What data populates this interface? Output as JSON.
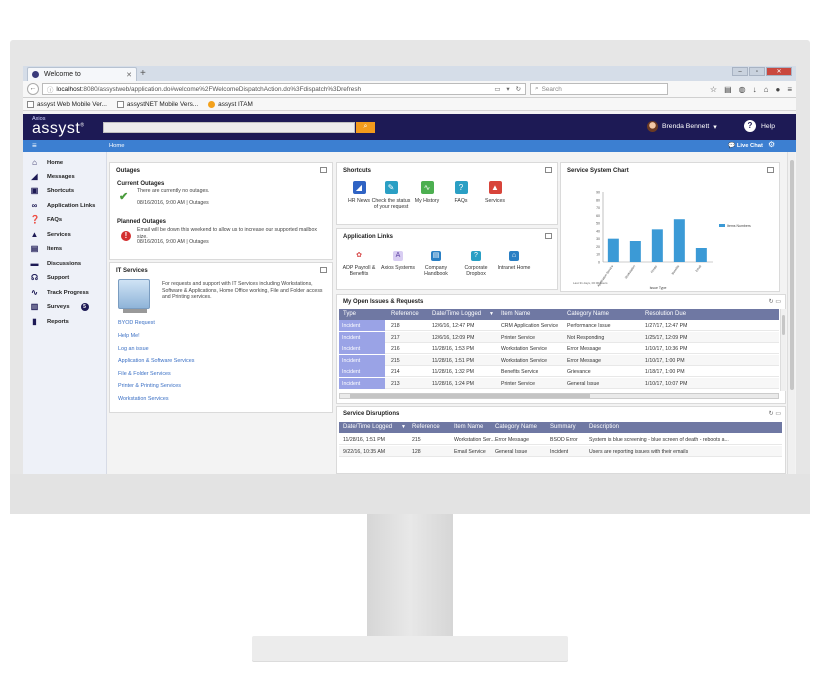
{
  "browser": {
    "tab_title": "Welcome to",
    "new_tab": "+",
    "url_host": "localhost",
    "url_rest": ":8080/assystweb/application.do#welcome%2FWelcomeDispatchAction.do%3Fdispatch%3Drefresh",
    "search_placeholder": "Search",
    "bookmarks": [
      "assyst Web Mobile Ver...",
      "assystNET Mobile Vers...",
      "assyst ITAM"
    ]
  },
  "app": {
    "logo_small": "Axios",
    "logo": "assyst",
    "user_name": "Brenda Bennett",
    "help_label": "Help",
    "breadcrumb": "Home",
    "live_chat": "Live Chat"
  },
  "sidebar": {
    "items": [
      {
        "label": "Home",
        "icon": "home-icon"
      },
      {
        "label": "Messages",
        "icon": "megaphone-icon"
      },
      {
        "label": "Shortcuts",
        "icon": "shortcuts-icon"
      },
      {
        "label": "Application Links",
        "icon": "link-icon"
      },
      {
        "label": "FAQs",
        "icon": "faq-icon"
      },
      {
        "label": "Services",
        "icon": "services-icon"
      },
      {
        "label": "Items",
        "icon": "items-icon"
      },
      {
        "label": "Discussions",
        "icon": "discussions-icon"
      },
      {
        "label": "Support",
        "icon": "support-icon"
      },
      {
        "label": "Track Progress",
        "icon": "track-progress-icon"
      },
      {
        "label": "Surveys",
        "icon": "surveys-icon",
        "badge": "5"
      },
      {
        "label": "Reports",
        "icon": "reports-icon"
      }
    ]
  },
  "outages": {
    "title": "Outages",
    "current_title": "Current Outages",
    "current_text": "There are currently no outages.",
    "current_meta": "08/16/2016, 9:00 AM  |  Outages",
    "planned_title": "Planned Outages",
    "planned_text": "Email will be down this weekend to allow us to increase our supported mailbox size.",
    "planned_meta": "08/16/2016, 9:00 AM  |  Outages"
  },
  "it_services": {
    "title": "IT Services",
    "description": "For requests and support with IT Services including Workstations, Software & Applications, Home Office working, File and Folder access and Printing services.",
    "links": [
      "BYOD Request",
      "Help Me!",
      "Log an issue",
      "Application & Software Services",
      "File & Folder Services",
      "Printer & Printing Services",
      "Workstation Services"
    ]
  },
  "shortcuts": {
    "title": "Shortcuts",
    "items": [
      {
        "label": "HR News",
        "color": "#2f63c4",
        "icon": "megaphone-icon"
      },
      {
        "label": "Check the status of your request",
        "color": "#2a9fc4",
        "icon": "lightbulb-icon"
      },
      {
        "label": "My History",
        "color": "#4caf50",
        "icon": "history-chart-icon"
      },
      {
        "label": "FAQs",
        "color": "#2a9fc4",
        "icon": "faq-icon"
      },
      {
        "label": "Services",
        "color": "#d8443a",
        "icon": "services-icon"
      }
    ]
  },
  "app_links": {
    "title": "Application Links",
    "items": [
      {
        "label": "ADP Payroll & Benefits",
        "icon": "payroll-icon"
      },
      {
        "label": "Axios Systems",
        "icon": "axios-icon"
      },
      {
        "label": "Company Handbook",
        "icon": "handbook-icon"
      },
      {
        "label": "Corporate Dropbox",
        "icon": "dropbox-icon"
      },
      {
        "label": "Intranet Home",
        "icon": "intranet-icon"
      }
    ]
  },
  "service_chart": {
    "title": "Service System Chart"
  },
  "chart_data": {
    "type": "bar",
    "categories": [
      "Application Service",
      "Workstation",
      "Printer",
      "Benefits",
      "Email"
    ],
    "values": [
      30,
      27,
      42,
      55,
      18
    ],
    "ylim": [
      0,
      90
    ],
    "yticks": [
      0,
      10,
      20,
      30,
      40,
      50,
      60,
      70,
      80,
      90
    ],
    "xlabel": "Issue Type",
    "legend": "Items Numbers",
    "footnote": "Last 31 days, 00:00 hours"
  },
  "open_issues": {
    "title": "My Open Issues & Requests",
    "columns": [
      "Type",
      "Reference",
      "Date/Time Logged",
      "Item Name",
      "Category Name",
      "Resolution Due"
    ],
    "rows": [
      [
        "Incident",
        "218",
        "12/6/16, 12:47 PM",
        "CRM Application Service",
        "Performance Issue",
        "1/27/17, 12:47 PM"
      ],
      [
        "Incident",
        "217",
        "12/6/16, 12:09 PM",
        "Printer Service",
        "Not Responding",
        "1/25/17, 12:09 PM"
      ],
      [
        "Incident",
        "216",
        "11/28/16, 1:53 PM",
        "Workstation Service",
        "Error Message",
        "1/10/17, 10:36 PM"
      ],
      [
        "Incident",
        "215",
        "11/28/16, 1:51 PM",
        "Workstation Service",
        "Error Message",
        "1/10/17, 1:00 PM"
      ],
      [
        "Incident",
        "214",
        "11/28/16, 1:32 PM",
        "Benefits Service",
        "Grievance",
        "1/18/17, 1:00 PM"
      ],
      [
        "Incident",
        "213",
        "11/28/16, 1:24 PM",
        "Printer Service",
        "General Issue",
        "1/10/17, 10:07 PM"
      ]
    ]
  },
  "disruptions": {
    "title": "Service Disruptions",
    "columns": [
      "Date/Time Logged",
      "Reference",
      "Item Name",
      "Category Name",
      "Summary",
      "Description"
    ],
    "rows": [
      [
        "11/28/16, 1:51 PM",
        "215",
        "Workstation Ser...",
        "Error Message",
        "BSOD Error",
        "System is blue screening - blue screen of death - reboots a..."
      ],
      [
        "9/22/16, 10:35 AM",
        "128",
        "Email Service",
        "General Issue",
        "Incident",
        "Users are reporting issues with their emails"
      ]
    ]
  }
}
